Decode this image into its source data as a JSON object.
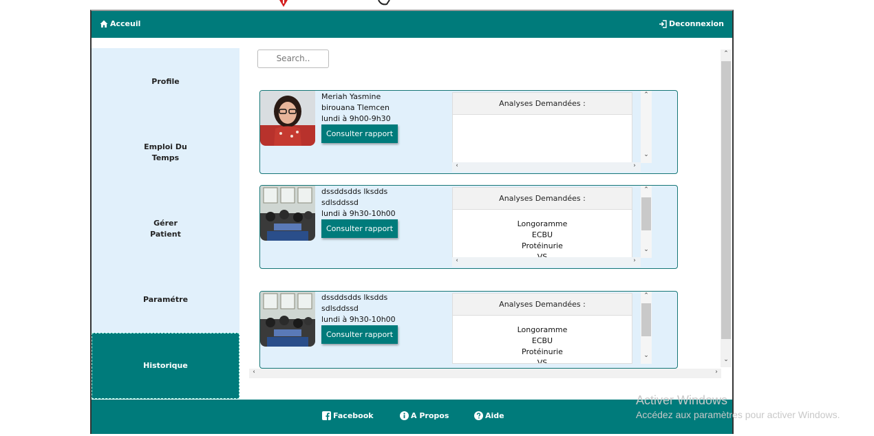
{
  "header": {
    "home_label": "Acceuil",
    "logout_label": "Deconnexion"
  },
  "sidebar": {
    "items": [
      {
        "label": "Profile"
      },
      {
        "label_line1": "Emploi Du",
        "label_line2": "Temps"
      },
      {
        "label_line1": "Gérer",
        "label_line2": "Patient"
      },
      {
        "label": "Paramétre"
      },
      {
        "label": "Historique"
      }
    ]
  },
  "search": {
    "placeholder": "Search.."
  },
  "cards": [
    {
      "name": "Meriah Yasmine",
      "location": "birouana Tlemcen",
      "schedule": "lundi à 9h00-9h30",
      "button": "Consulter rapport",
      "analyses_title": "Analyses Demandées :",
      "analyses": []
    },
    {
      "name": "dssddsdds lksdds",
      "location": "sdlsddssd",
      "schedule": "lundi à 9h30-10h00",
      "button": "Consulter rapport",
      "analyses_title": "Analyses Demandées :",
      "analyses": [
        "Longoramme",
        "ECBU",
        "Protéinurie",
        "VS"
      ]
    },
    {
      "name": "dssddsdds lksdds",
      "location": "sdlsddssd",
      "schedule": "lundi à 9h30-10h00",
      "button": "Consulter rapport",
      "analyses_title": "Analyses Demandées :",
      "analyses": [
        "Longoramme",
        "ECBU",
        "Protéinurie",
        "VS"
      ]
    }
  ],
  "footer": {
    "facebook": "Facebook",
    "about": "A Propos",
    "help": "Aide"
  },
  "watermark": {
    "line1": "Activer Windows",
    "line2": "Accédez aux paramètres pour activer Windows."
  },
  "colors": {
    "primary": "#007b7b",
    "sidebar_bg": "#e1f0fb",
    "card_border": "#137575"
  }
}
